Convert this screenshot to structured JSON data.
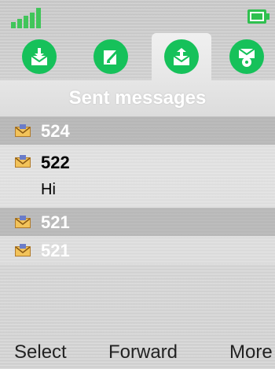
{
  "title": "Sent messages",
  "tabs": [
    {
      "name": "inbox"
    },
    {
      "name": "compose"
    },
    {
      "name": "sent"
    },
    {
      "name": "message-settings"
    }
  ],
  "messages": [
    {
      "number": "524",
      "preview": ""
    },
    {
      "number": "522",
      "preview": "Hi"
    },
    {
      "number": "521",
      "preview": ""
    },
    {
      "number": "521",
      "preview": ""
    }
  ],
  "softkeys": {
    "left": "Select",
    "center": "Forward",
    "right": "More"
  },
  "colors": {
    "accent": "#16c15a",
    "signal": "#41c55a",
    "battery": "#2fc04f"
  },
  "icons": {
    "signal": "signal-icon",
    "battery": "battery-icon",
    "envelope": "envelope-icon"
  }
}
